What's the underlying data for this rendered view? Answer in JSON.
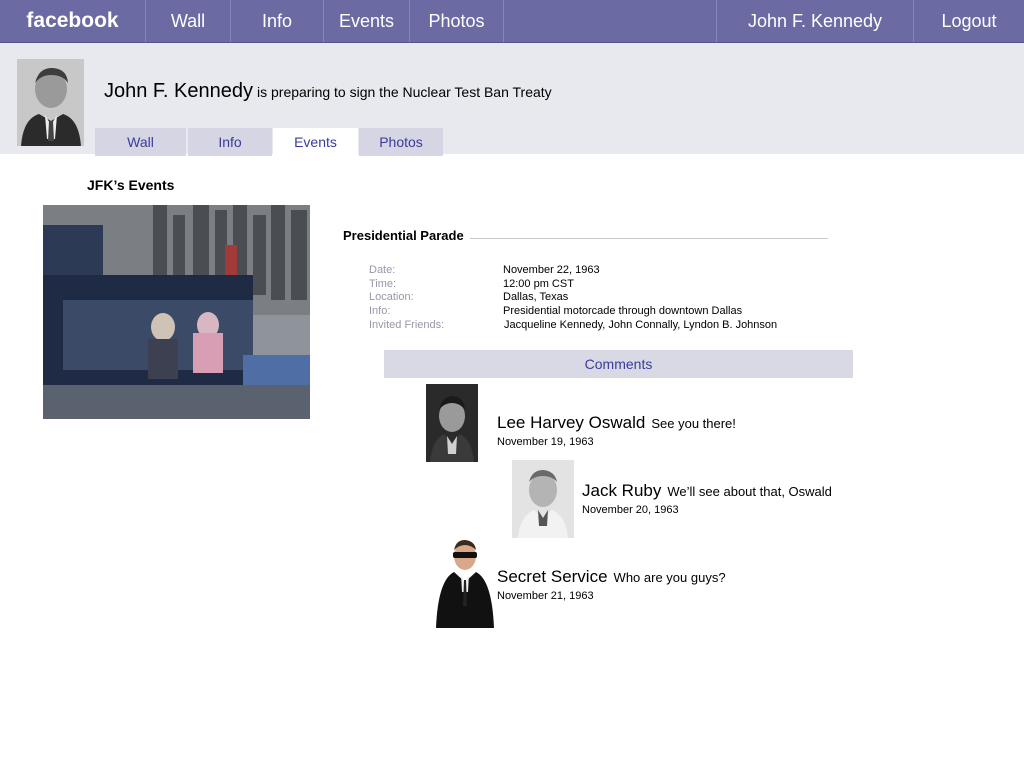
{
  "topbar": {
    "logo": "facebook",
    "nav": [
      "Wall",
      "Info",
      "Events",
      "Photos"
    ],
    "user": "John F. Kennedy",
    "logout": "Logout"
  },
  "profile": {
    "name": "John F. Kennedy",
    "status": "is preparing to sign the Nuclear Test Ban Treaty",
    "tabs": [
      "Wall",
      "Info",
      "Events",
      "Photos"
    ],
    "active_tab": "Events"
  },
  "events": {
    "section_title": "JFK’s Events",
    "event": {
      "title": "Presidential Parade",
      "fields": [
        {
          "label": "Date:",
          "value": "November 22, 1963"
        },
        {
          "label": "Time:",
          "value": "12:00 pm CST"
        },
        {
          "label": "Location:",
          "value": "Dallas, Texas"
        },
        {
          "label": "Info:",
          "value": "Presidential motorcade through downtown Dallas"
        },
        {
          "label": "Invited Friends:",
          "value": "Jacqueline Kennedy, John Connally, Lyndon B. Johnson"
        }
      ]
    },
    "comments_label": "Comments",
    "comments": [
      {
        "name": "Lee Harvey Oswald",
        "message": "See you there!",
        "date": "November 19, 1963"
      },
      {
        "name": "Jack Ruby",
        "message": "We’ll see about that, Oswald",
        "date": "November 20, 1963"
      },
      {
        "name": "Secret Service",
        "message": "Who are you guys?",
        "date": "November 21, 1963"
      }
    ]
  },
  "colors": {
    "topbar_bg": "#6b6aa3",
    "profile_band_bg": "#e8e8ef",
    "tab_bg": "#d5d5e3",
    "link_text": "#3b3b9a",
    "label_gray": "#9898a8"
  }
}
